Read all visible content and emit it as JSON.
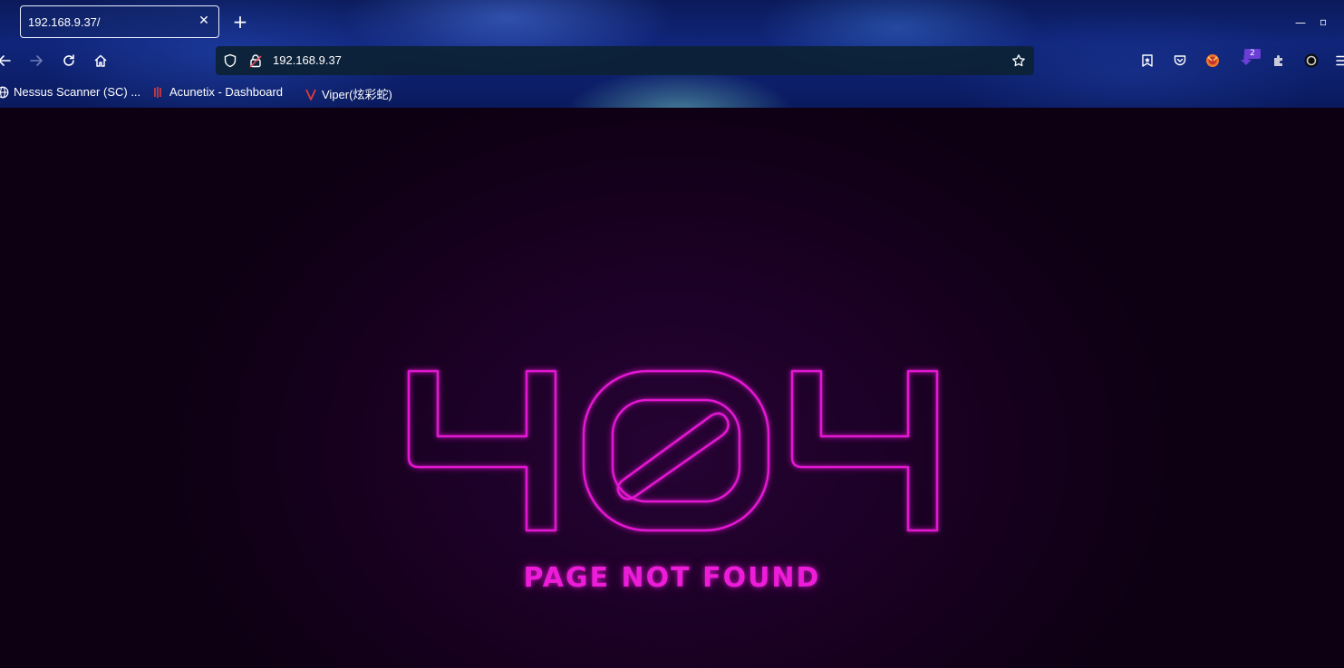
{
  "browser": {
    "tab": {
      "title": "192.168.9.37/",
      "close_icon": "close-icon"
    },
    "new_tab_icon": "plus-icon",
    "window_controls": {
      "minimize_glyph": "—",
      "maximize_glyph": "▫"
    },
    "nav": {
      "back_icon": "arrow-left-icon",
      "forward_icon": "arrow-right-icon",
      "reload_icon": "reload-icon",
      "home_icon": "home-icon"
    },
    "urlbar": {
      "url": "192.168.9.37",
      "shield_icon": "shield-icon",
      "lock_icon": "insecure-lock-icon",
      "bookmark_star_icon": "star-icon"
    },
    "toolbar_right": {
      "icons": [
        "bookmark-star-list-icon",
        "pocket-icon",
        "extension-fox-icon",
        "download-extension-icon",
        "puzzle-icon",
        "circle-extension-icon",
        "menu-icon"
      ],
      "badge_count": "2"
    },
    "bookmarks": [
      {
        "label": "Nessus Scanner (SC) ...",
        "icon": "globe-icon"
      },
      {
        "label": "Acunetix - Dashboard",
        "icon": "acunetix-icon"
      },
      {
        "label": "Viper(炫彩蛇)",
        "icon": "viper-icon"
      }
    ]
  },
  "page": {
    "heading": "404",
    "message": "PAGE NOT FOUND",
    "neon_color": "#e516d3",
    "background_color": "#130016"
  }
}
